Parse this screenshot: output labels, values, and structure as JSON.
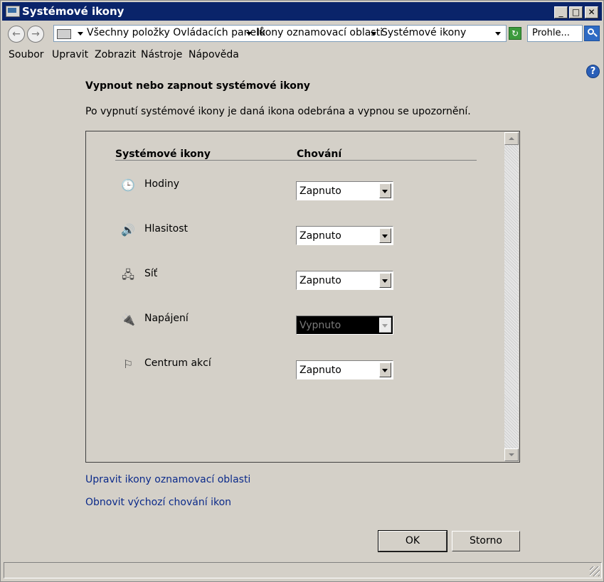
{
  "window": {
    "title": "Systémové ikony"
  },
  "address": {
    "crumbs": [
      "Všechny položky Ovládacích panelů",
      "Ikony oznamovací oblasti",
      "Systémové ikony"
    ],
    "search_placeholder": "Prohle..."
  },
  "menu": [
    "Soubor",
    "Upravit",
    "Zobrazit",
    "Nástroje",
    "Nápověda"
  ],
  "content": {
    "heading": "Vypnout nebo zapnout systémové ikony",
    "description": "Po vypnutí systémové ikony je daná ikona odebrána a vypnou se upozornění.",
    "col_icons": "Systémové ikony",
    "col_behavior": "Chování",
    "rows": [
      {
        "label": "Hodiny",
        "value": "Zapnuto",
        "icon": "clock-icon",
        "enabled": true
      },
      {
        "label": "Hlasitost",
        "value": "Zapnuto",
        "icon": "speaker-icon",
        "enabled": true
      },
      {
        "label": "Síť",
        "value": "Zapnuto",
        "icon": "network-icon",
        "enabled": true
      },
      {
        "label": "Napájení",
        "value": "Vypnuto",
        "icon": "power-icon",
        "enabled": false
      },
      {
        "label": "Centrum akcí",
        "value": "Zapnuto",
        "icon": "flag-icon",
        "enabled": true
      }
    ],
    "link_customize": "Upravit ikony oznamovací oblasti",
    "link_restore": "Obnovit výchozí chování ikon"
  },
  "buttons": {
    "ok": "OK",
    "cancel": "Storno"
  }
}
